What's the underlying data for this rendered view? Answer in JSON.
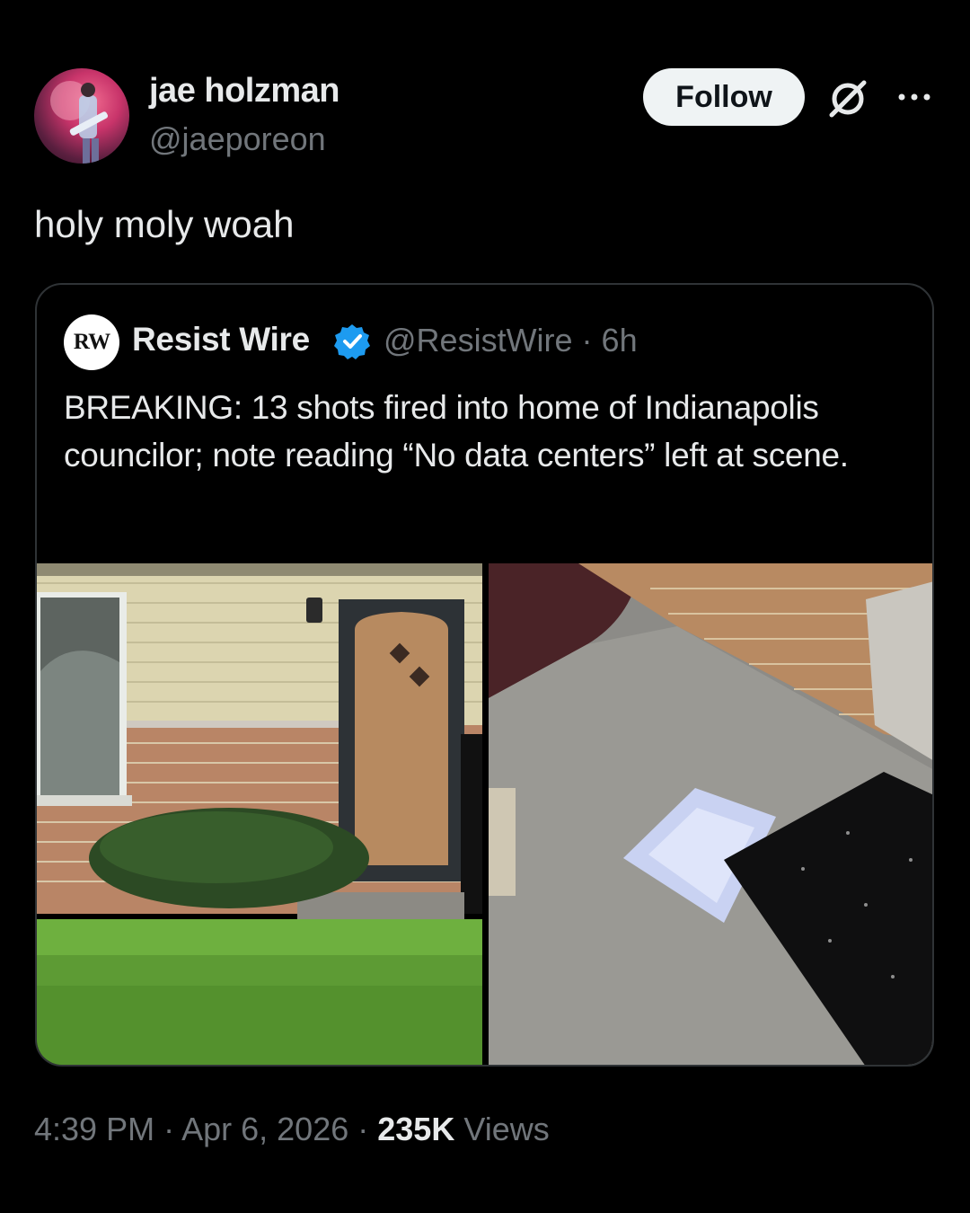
{
  "author": {
    "display_name": "jae holzman",
    "handle": "@jaeporeon"
  },
  "actions": {
    "follow_label": "Follow",
    "grok_icon": "grok-icon",
    "more_icon": "more-icon"
  },
  "tweet": {
    "text": "holy moly woah"
  },
  "quoted": {
    "avatar_initials": "RW",
    "name": "Resist Wire",
    "verified_icon": "verified-badge-icon",
    "handle_time": "@ResistWire · 6h",
    "text": "BREAKING: 13 shots fired into home of Indianapolis councilor; note reading “No data centers” left at scene.",
    "media": [
      {
        "description_icon": "house-photo"
      },
      {
        "description_icon": "porch-note-photo"
      }
    ]
  },
  "footer": {
    "time": "4:39 PM",
    "date": "Apr 6, 2026",
    "views_count": "235K",
    "views_label": "Views"
  },
  "colors": {
    "background": "#000000",
    "text": "#e7e9ea",
    "muted": "#71767b",
    "border": "#2f3336",
    "verified": "#1d9bf0"
  }
}
